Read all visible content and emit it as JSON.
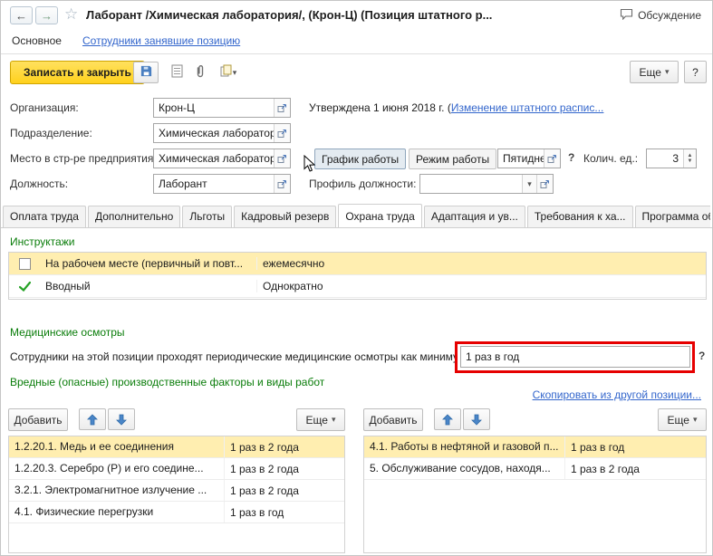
{
  "icons": {
    "back": "←",
    "forward": "→",
    "star": "☆",
    "caret": "▾",
    "up_small": "▲",
    "down_small": "▼"
  },
  "colors": {
    "accent_yellow": "#ffd11d",
    "section_green": "#0a7d0a",
    "link_blue": "#3366cc",
    "selected_row": "#ffeeb0",
    "annotation_red": "#e60000"
  },
  "header": {
    "title": "Лаборант /Химическая лаборатория/, (Крон-Ц) (Позиция штатного р...",
    "discussion": "Обсуждение"
  },
  "nav": {
    "main": "Основное",
    "employees": "Сотрудники занявшие позицию"
  },
  "toolbar": {
    "save_close": "Записать и закрыть",
    "more": "Еще",
    "help": "?"
  },
  "form": {
    "org_label": "Организация:",
    "org_value": "Крон-Ц",
    "approved_text": "Утверждена 1 июня 2018 г. (",
    "approved_link": "Изменение штатного распис...",
    "dept_label": "Подразделение:",
    "dept_value": "Химическая лаборатория",
    "place_label": "Место в стр-ре предприятия:",
    "place_value": "Химическая лаборатория",
    "schedule_button": "График работы",
    "mode_button": "Режим работы",
    "schedule_value": "Пятидневк...",
    "schedule_help": "?",
    "qty_label": "Колич. ед.:",
    "qty_value": "3",
    "position_label": "Должность:",
    "position_value": "Лаборант",
    "profile_label": "Профиль должности:",
    "profile_value": ""
  },
  "tabs": {
    "items": [
      {
        "label": "Оплата труда"
      },
      {
        "label": "Дополнительно"
      },
      {
        "label": "Льготы"
      },
      {
        "label": "Кадровый резерв"
      },
      {
        "label": "Охрана труда"
      },
      {
        "label": "Адаптация и ув..."
      },
      {
        "label": "Требования к ха..."
      },
      {
        "label": "Программа обу..."
      }
    ]
  },
  "instructions": {
    "header": "Инструктажи",
    "rows": [
      {
        "name": "На рабочем месте (первичный и повт...",
        "period": "ежемесячно"
      },
      {
        "name": "Вводный",
        "period": "Однократно"
      }
    ]
  },
  "medical": {
    "header": "Медицинские осмотры",
    "text": "Сотрудники на этой позиции проходят периодические медицинские осмотры как минимум:",
    "value": "1 раз в год",
    "help": "?"
  },
  "factors": {
    "header": "Вредные (опасные) производственные факторы и виды работ",
    "copy_link": "Скопировать из другой позиции...",
    "add": "Добавить",
    "more": "Еще",
    "left": {
      "rows": [
        {
          "name": "1.2.20.1. Медь и ее соединения",
          "period": "1 раз в 2 года"
        },
        {
          "name": "1.2.20.3. Серебро (Р) и его соедине...",
          "period": "1 раз в 2 года"
        },
        {
          "name": "3.2.1. Электромагнитное излучение ...",
          "period": "1 раз в 2 года"
        },
        {
          "name": "4.1. Физические перегрузки",
          "period": "1 раз в год"
        }
      ]
    },
    "right": {
      "rows": [
        {
          "name": "4.1. Работы в нефтяной и газовой п...",
          "period": "1 раз в год"
        },
        {
          "name": "5. Обслуживание сосудов, находя...",
          "period": "1 раз в 2 года"
        }
      ]
    }
  }
}
